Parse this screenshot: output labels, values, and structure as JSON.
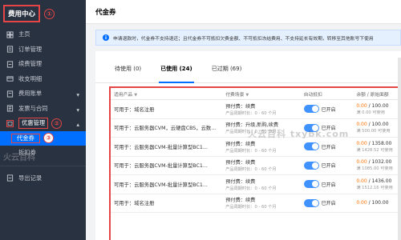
{
  "sidebar": {
    "title": "费用中心",
    "title_badge": "①",
    "items": [
      {
        "label": "主页",
        "icon": "home-icon"
      },
      {
        "label": "订单管理",
        "icon": "order-icon"
      },
      {
        "label": "续费管理",
        "icon": "renew-icon"
      },
      {
        "label": "收支明细",
        "icon": "ledger-icon"
      },
      {
        "label": "费用账单",
        "icon": "bill-icon"
      },
      {
        "label": "发票与合同",
        "icon": "invoice-icon"
      },
      {
        "label": "优惠管理",
        "icon": "discount-icon",
        "badge": "②"
      },
      {
        "label": "代金券",
        "badge": "③"
      },
      {
        "label": "折扣券"
      },
      {
        "label": "导出记录",
        "icon": "export-icon"
      }
    ]
  },
  "header": {
    "title": "代金券"
  },
  "notice": {
    "text": "申请退款时，代金券不支持退还；且代金券不可抵扣欠费金额、不可抵扣冻结费用、不支持延长有效期，转移至其他账号下使用"
  },
  "tabs": [
    {
      "label": "待使用 (0)"
    },
    {
      "label": "已使用 (24)"
    },
    {
      "label": "已过期 (69)"
    }
  ],
  "table": {
    "headers": [
      "适用产品",
      "付费场景",
      "自动抵扣",
      "余额 / 原始面额"
    ],
    "rows": [
      {
        "product": "可用于：域名注册",
        "scene": "预付费：续费",
        "limit": "产品周期时长：0 - 60 个月",
        "toggle": "已开启",
        "amount": "0.00",
        "total": "100.00",
        "cond": "满 0.00 可使用"
      },
      {
        "product": "可用于：云服务器CVM，云硬盘CBS，云数...",
        "scene": "预付费：升级,新购,续费",
        "limit": "产品周期时长：0 - 60 个月",
        "toggle": "已开启",
        "amount": "0.00",
        "total": "100.00",
        "cond": "满 500.00 可使用"
      },
      {
        "product": "可用于：云服务器CVM-批量计算型BC1...",
        "scene": "预付费：续费",
        "limit": "产品周期时长：0 - 60 个月",
        "toggle": "已开启",
        "amount": "0.00",
        "total": "1358.00",
        "cond": "满 1428.52 可使用"
      },
      {
        "product": "可用于：云服务器CVM-批量计算型BC1...",
        "scene": "预付费：续费",
        "limit": "产品周期时长：0 - 60 个月",
        "toggle": "已开启",
        "amount": "0.00",
        "total": "1032.00",
        "cond": "满 1085.00 可使用"
      },
      {
        "product": "可用于：云服务器CVM-批量计算型BC1...",
        "scene": "预付费：续费",
        "limit": "产品周期时长：0 - 60 个月",
        "toggle": "已开启",
        "amount": "0.00",
        "total": "1436.00",
        "cond": "满 1512.16 可使用"
      },
      {
        "product": "可用于：域名注册",
        "scene": "预付费：续费",
        "limit": "产品周期时长：0 - 60 个月",
        "toggle": "已开启",
        "amount": "0.00",
        "total": "100.00",
        "cond": ""
      }
    ]
  },
  "watermark": "火云百科 txybk.com",
  "watermark2": "火云百科",
  "colors": {
    "accent": "#006eff",
    "sidebar": "#293241",
    "highlight": "#e54545",
    "price": "#ff7200"
  }
}
